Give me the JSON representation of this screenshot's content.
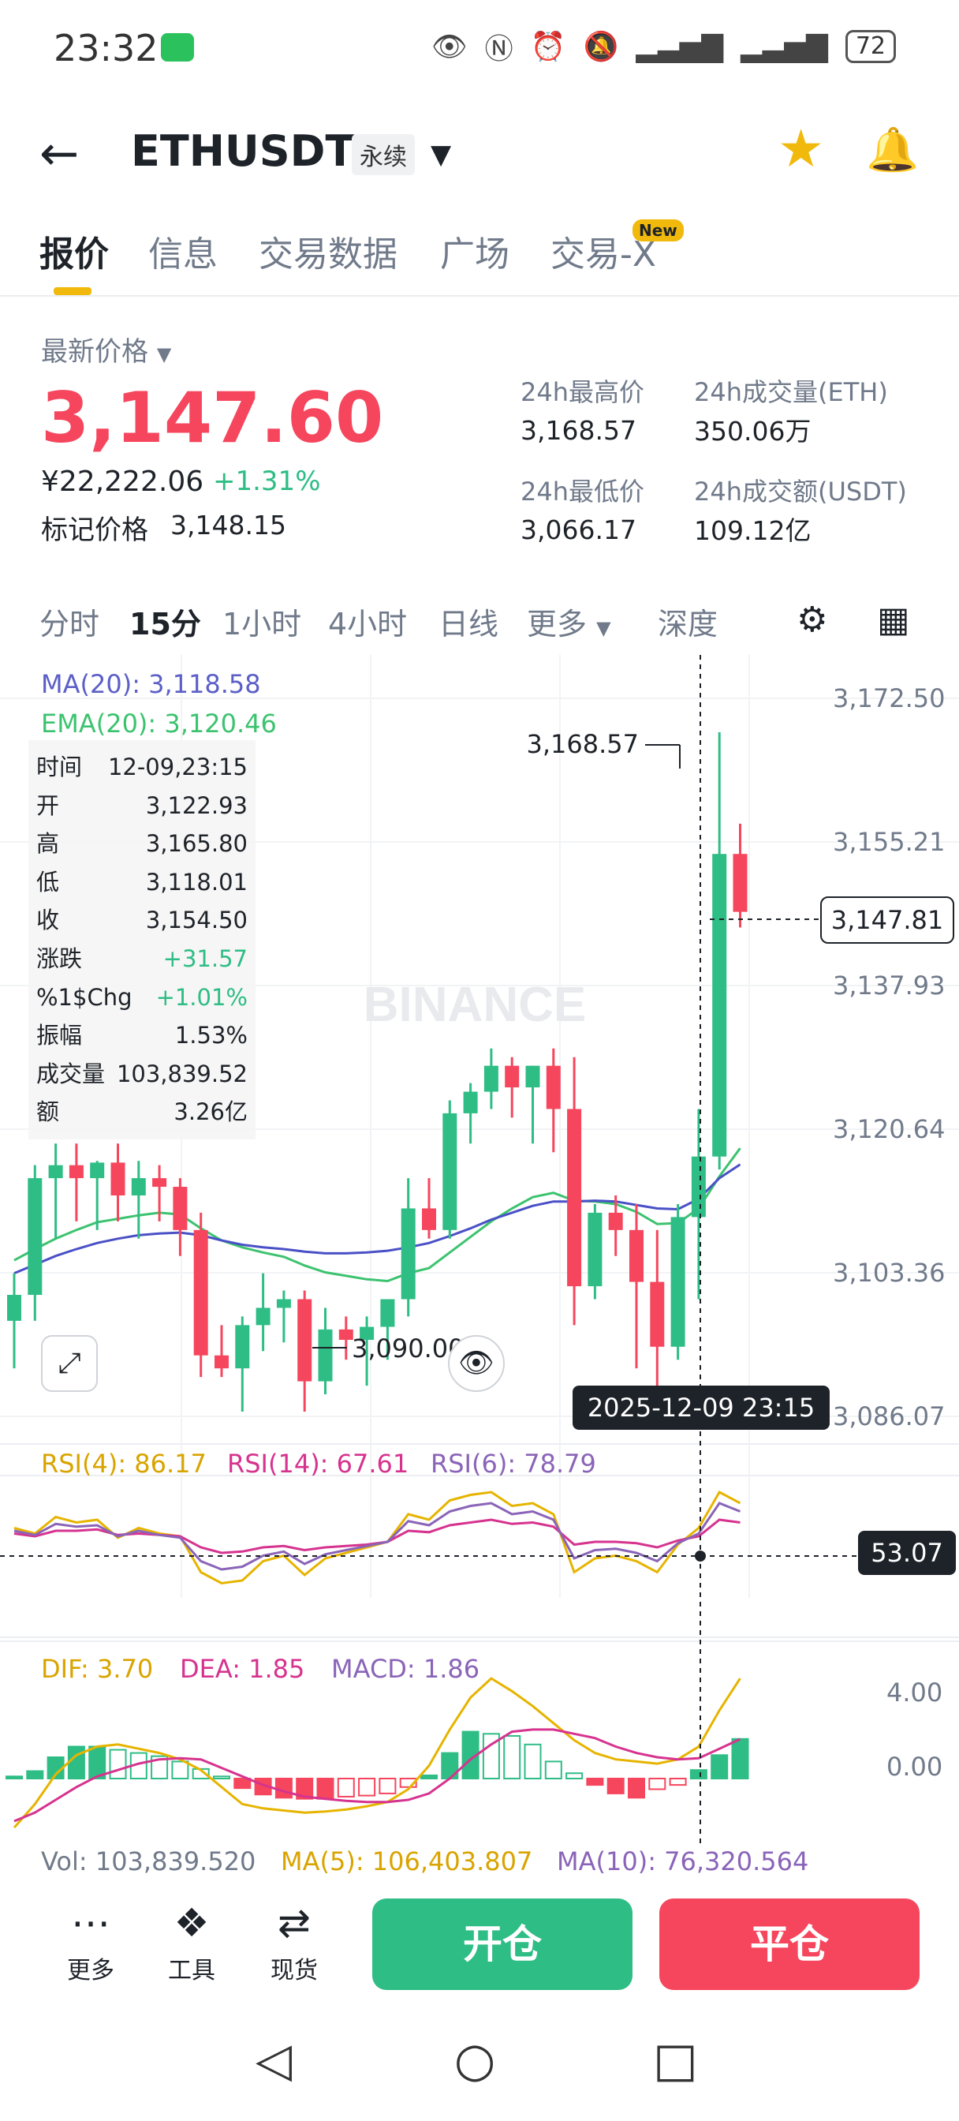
{
  "status": {
    "time": "23:32",
    "battery": "72"
  },
  "header": {
    "symbol": "ETHUSDT",
    "badge": "永续",
    "starred": true
  },
  "tabs": [
    {
      "label": "报价",
      "active": true
    },
    {
      "label": "信息"
    },
    {
      "label": "交易数据"
    },
    {
      "label": "广场"
    },
    {
      "label": "交易-X",
      "badge": "New"
    }
  ],
  "price": {
    "label": "最新价格",
    "last": "3,147.60",
    "cny": "¥22,222.06",
    "change": "+1.31%",
    "mark_label": "标记价格",
    "mark_value": "3,148.15"
  },
  "stats": {
    "high_label": "24h最高价",
    "high": "3,168.57",
    "low_label": "24h最低价",
    "low": "3,066.17",
    "vol_label": "24h成交量(ETH)",
    "vol": "350.06万",
    "amt_label": "24h成交额(USDT)",
    "amt": "109.12亿"
  },
  "chart_tabs": [
    "分时",
    "15分",
    "1小时",
    "4小时",
    "日线",
    "更多",
    "深度"
  ],
  "chart_tab_active": "15分",
  "indicators": {
    "ma": "MA(20): 3,118.58",
    "ema": "EMA(20): 3,120.46",
    "rsi4": "RSI(4): 86.17",
    "rsi14": "RSI(14): 67.61",
    "rsi6": "RSI(6): 78.79",
    "dif": "DIF: 3.70",
    "dea": "DEA: 1.85",
    "macd": "MACD: 1.86",
    "vol": "Vol: 103,839.520",
    "vol_ma5": "MA(5): 106,403.807",
    "vol_ma10": "MA(10): 76,320.564"
  },
  "tooltip": [
    {
      "k": "时间",
      "v": "12-09,23:15"
    },
    {
      "k": "开",
      "v": "3,122.93"
    },
    {
      "k": "高",
      "v": "3,165.80"
    },
    {
      "k": "低",
      "v": "3,118.01"
    },
    {
      "k": "收",
      "v": "3,154.50"
    },
    {
      "k": "涨跌",
      "v": "+31.57"
    },
    {
      "k": "%1$Chg",
      "v": "+1.01%"
    },
    {
      "k": "振幅",
      "v": "1.53%"
    },
    {
      "k": "成交量",
      "v": "103,839.52"
    },
    {
      "k": "额",
      "v": "3.26亿"
    }
  ],
  "axis": [
    "3,172.50",
    "3,155.21",
    "3,137.93",
    "3,120.64",
    "3,103.36",
    "3,086.07"
  ],
  "annotations": {
    "high_marker": "3,168.57",
    "low_marker": "3,090.00",
    "current_price": "3,147.81",
    "crosshair_time": "2025-12-09 23:15",
    "rsi_value": "53.07",
    "macd_axis_top": "4.00",
    "macd_axis_zero": "0.00",
    "watermark": "BINANCE"
  },
  "bottom": {
    "more": "更多",
    "tools": "工具",
    "spot": "现货",
    "open": "开仓",
    "close": "平仓"
  },
  "colors": {
    "up": "#2ebd85",
    "down": "#f6465d",
    "accent": "#f0b90b"
  },
  "chart_data": [
    {
      "type": "candlestick",
      "interval": "15分",
      "ylim": [
        3086.07,
        3172.5
      ],
      "candles": [
        [
          3100.5,
          3106,
          3095,
          3103.5
        ],
        [
          3103.5,
          3118.5,
          3100.5,
          3117
        ],
        [
          3117,
          3121,
          3110,
          3118.5
        ],
        [
          3118.5,
          3121,
          3112,
          3117
        ],
        [
          3117,
          3119,
          3111,
          3118.8
        ],
        [
          3118.8,
          3121,
          3112,
          3115
        ],
        [
          3115,
          3119,
          3110,
          3117
        ],
        [
          3117,
          3118.5,
          3112,
          3116
        ],
        [
          3116,
          3117,
          3108,
          3111
        ],
        [
          3111,
          3113,
          3094,
          3096.5
        ],
        [
          3096.5,
          3100,
          3094,
          3095
        ],
        [
          3095,
          3101,
          3090,
          3100
        ],
        [
          3100,
          3106,
          3097,
          3102
        ],
        [
          3102,
          3104,
          3098,
          3103
        ],
        [
          3103,
          3104,
          3090,
          3093.5
        ],
        [
          3093.5,
          3102,
          3092,
          3099.5
        ],
        [
          3099.5,
          3101,
          3096,
          3098.3
        ],
        [
          3098.3,
          3101,
          3093,
          3099.8
        ],
        [
          3099.8,
          3103,
          3096,
          3103
        ],
        [
          3103,
          3117,
          3101,
          3113.5
        ],
        [
          3113.5,
          3117,
          3110,
          3111
        ],
        [
          3111,
          3126,
          3110,
          3124.5
        ],
        [
          3124.5,
          3128,
          3121,
          3127
        ],
        [
          3127,
          3132,
          3125,
          3130
        ],
        [
          3130,
          3131,
          3124,
          3127.5
        ],
        [
          3127.5,
          3130,
          3121,
          3130
        ],
        [
          3130,
          3132,
          3120,
          3125
        ],
        [
          3125,
          3131,
          3100,
          3104.5
        ],
        [
          3104.5,
          3114,
          3103,
          3113
        ],
        [
          3113,
          3115,
          3108,
          3111
        ],
        [
          3111,
          3114,
          3095,
          3105
        ],
        [
          3105,
          3111,
          3089,
          3097.5
        ],
        [
          3097.5,
          3114,
          3096,
          3112.5
        ],
        [
          3112.5,
          3125,
          3103,
          3119.5
        ],
        [
          3119.5,
          3168.57,
          3118,
          3154.5
        ],
        [
          3154.5,
          3158,
          3146,
          3147.8
        ]
      ],
      "ma20": [
        3106,
        3107,
        3108,
        3108.8,
        3109.5,
        3110,
        3110.4,
        3110.6,
        3110.7,
        3110.4,
        3109.8,
        3109.3,
        3109,
        3108.8,
        3108.5,
        3108.3,
        3108.3,
        3108.4,
        3108.6,
        3109,
        3109.5,
        3110.3,
        3111.2,
        3112.2,
        3113,
        3113.8,
        3114.3,
        3114.3,
        3114.4,
        3114.3,
        3113.9,
        3113.5,
        3113.4,
        3114.6,
        3117,
        3118.58
      ],
      "ema20": [
        3107.5,
        3108.8,
        3110,
        3111,
        3111.9,
        3112.3,
        3112.7,
        3113,
        3112.8,
        3111.2,
        3109.8,
        3109,
        3108.4,
        3107.9,
        3106.9,
        3106.1,
        3105.7,
        3105.3,
        3105.1,
        3106,
        3106.6,
        3108.4,
        3110.2,
        3112,
        3113.5,
        3114.8,
        3115.3,
        3114.4,
        3114.3,
        3114,
        3113.1,
        3111.7,
        3111.8,
        3113.5,
        3117.2,
        3120.46
      ]
    },
    {
      "type": "line",
      "name": "RSI",
      "ylim": [
        0,
        100
      ],
      "series": [
        {
          "name": "RSI(4)",
          "values": [
            62,
            58,
            70,
            66,
            68,
            55,
            62,
            58,
            56,
            30,
            22,
            24,
            38,
            42,
            28,
            40,
            44,
            48,
            52,
            72,
            68,
            82,
            86,
            88,
            78,
            80,
            72,
            30,
            40,
            42,
            38,
            30,
            50,
            62,
            88,
            80
          ]
        },
        {
          "name": "RSI(14)",
          "values": [
            58,
            56,
            60,
            60,
            61,
            57,
            58,
            57,
            56,
            48,
            44,
            45,
            48,
            49,
            46,
            48,
            49,
            50,
            52,
            60,
            59,
            64,
            66,
            68,
            65,
            66,
            63,
            50,
            52,
            52,
            51,
            48,
            53,
            56,
            68,
            66
          ]
        },
        {
          "name": "RSI(6)",
          "values": [
            60,
            57,
            65,
            63,
            64,
            56,
            60,
            57,
            55,
            38,
            32,
            34,
            42,
            45,
            36,
            43,
            46,
            49,
            52,
            67,
            64,
            74,
            78,
            80,
            72,
            74,
            68,
            40,
            46,
            47,
            44,
            38,
            51,
            58,
            80,
            74
          ]
        }
      ]
    },
    {
      "type": "bar",
      "name": "MACD",
      "ylim": [
        -3,
        6
      ],
      "hist": [
        0.1,
        0.35,
        1.0,
        1.5,
        1.5,
        1.35,
        1.2,
        1.05,
        0.8,
        0.45,
        0.1,
        -0.45,
        -0.75,
        -0.9,
        -0.95,
        -0.95,
        -0.85,
        -0.8,
        -0.7,
        -0.4,
        0.15,
        1.2,
        2.2,
        2.1,
        2.0,
        1.6,
        0.8,
        0.25,
        -0.3,
        -0.7,
        -0.9,
        -0.5,
        -0.3,
        0.4,
        1.1,
        1.86
      ],
      "series": [
        {
          "name": "DIF",
          "values": [
            -2.3,
            -1.2,
            0.2,
            1.1,
            1.5,
            1.6,
            1.4,
            1.2,
            0.9,
            0.4,
            -0.4,
            -1.2,
            -1.4,
            -1.5,
            -1.6,
            -1.55,
            -1.45,
            -1.3,
            -1.1,
            -0.5,
            0.6,
            2.3,
            3.8,
            4.7,
            4.1,
            3.4,
            2.6,
            1.8,
            1.2,
            0.9,
            0.8,
            0.7,
            0.9,
            1.5,
            3.2,
            4.7
          ]
        },
        {
          "name": "DEA",
          "values": [
            -2.0,
            -1.6,
            -1.0,
            -0.4,
            0.1,
            0.4,
            0.7,
            0.9,
            0.95,
            0.9,
            0.5,
            0.1,
            -0.3,
            -0.6,
            -0.85,
            -0.95,
            -1.05,
            -1.1,
            -1.1,
            -1.0,
            -0.7,
            0.0,
            0.9,
            1.6,
            2.2,
            2.3,
            2.3,
            2.1,
            1.9,
            1.5,
            1.2,
            1.0,
            0.9,
            0.95,
            1.4,
            1.85
          ]
        }
      ]
    }
  ]
}
